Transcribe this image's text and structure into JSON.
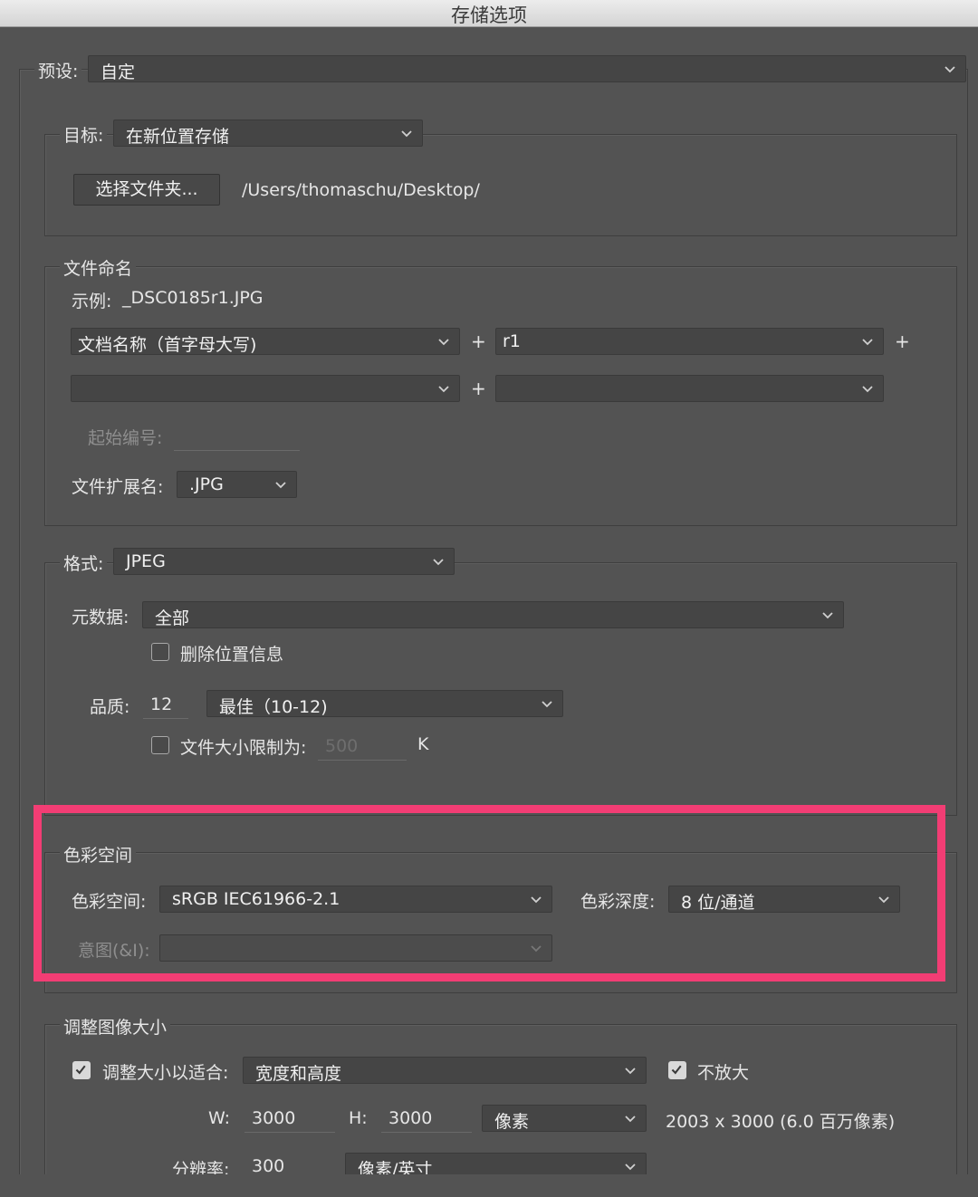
{
  "window": {
    "title": "存储选项"
  },
  "preset": {
    "label": "预设:",
    "value": "自定"
  },
  "destination": {
    "label": "目标:",
    "value": "在新位置存储",
    "choose_folder_button": "选择文件夹...",
    "path": "/Users/thomaschu/Desktop/"
  },
  "file_naming": {
    "heading": "文件命名",
    "example_label": "示例:",
    "example_value": "_DSC0185r1.JPG",
    "field1": "文档名称（首字母大写)",
    "field2": "r1",
    "field3": "",
    "field4": "",
    "plus": "+",
    "start_number_label": "起始编号:",
    "start_number_value": "",
    "extension_label": "文件扩展名:",
    "extension_value": ".JPG"
  },
  "format": {
    "label": "格式:",
    "value": "JPEG",
    "metadata_label": "元数据:",
    "metadata_value": "全部",
    "remove_location_label": "删除位置信息",
    "quality_label": "品质:",
    "quality_value": "12",
    "quality_preset": "最佳（10-12)",
    "file_size_limit_label": "文件大小限制为:",
    "file_size_limit_value": "500",
    "file_size_unit": "K"
  },
  "color_space": {
    "heading": "色彩空间",
    "space_label": "色彩空间:",
    "space_value": "sRGB IEC61966-2.1",
    "depth_label": "色彩深度:",
    "depth_value": "8 位/通道",
    "intent_label": "意图(&I):",
    "intent_value": ""
  },
  "resize": {
    "heading": "调整图像大小",
    "fit_label": "调整大小以适合:",
    "fit_value": "宽度和高度",
    "no_enlarge_label": "不放大",
    "w_label": "W:",
    "w_value": "3000",
    "h_label": "H:",
    "h_value": "3000",
    "unit_value": "像素",
    "size_info": "2003 x 3000 (6.0 百万像素)",
    "resolution_label": "分辨率:",
    "resolution_value": "300",
    "resolution_unit": "像素/英寸"
  },
  "checkboxes": {
    "remove_location": false,
    "file_size_limit": false,
    "resize_to_fit": true,
    "dont_enlarge": true
  },
  "colors": {
    "background": "#535353",
    "control": "#454545",
    "highlight": "#f23d74"
  }
}
